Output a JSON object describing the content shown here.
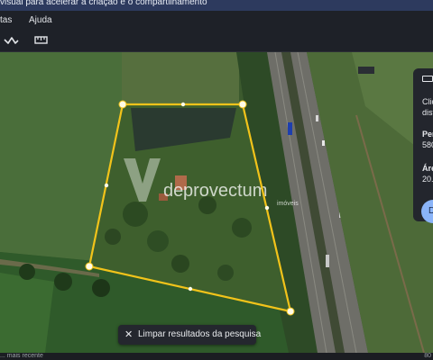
{
  "banner": {
    "text": "visual para acelerar a criação e o compartilhamento"
  },
  "menu": {
    "items": [
      "tas",
      "Ajuda"
    ]
  },
  "toolbar": {
    "tools": [
      {
        "icon": "path-tool-icon"
      },
      {
        "icon": "ruler-icon"
      }
    ]
  },
  "map": {
    "polygon_color": "#f2c31a",
    "watermark": {
      "brand_prefix": "de",
      "brand_name": "provectum",
      "subtitle": "imóveis"
    }
  },
  "panel": {
    "line1": "Clic",
    "line2": "dist",
    "perimeter_label": "Per",
    "perimeter_value": "580",
    "area_label": "Áre",
    "area_value": "20.",
    "action_label": "D"
  },
  "clear_results": {
    "label": "Limpar resultados da pesquisa"
  },
  "status": {
    "left": "... mais recente",
    "right": "80"
  }
}
